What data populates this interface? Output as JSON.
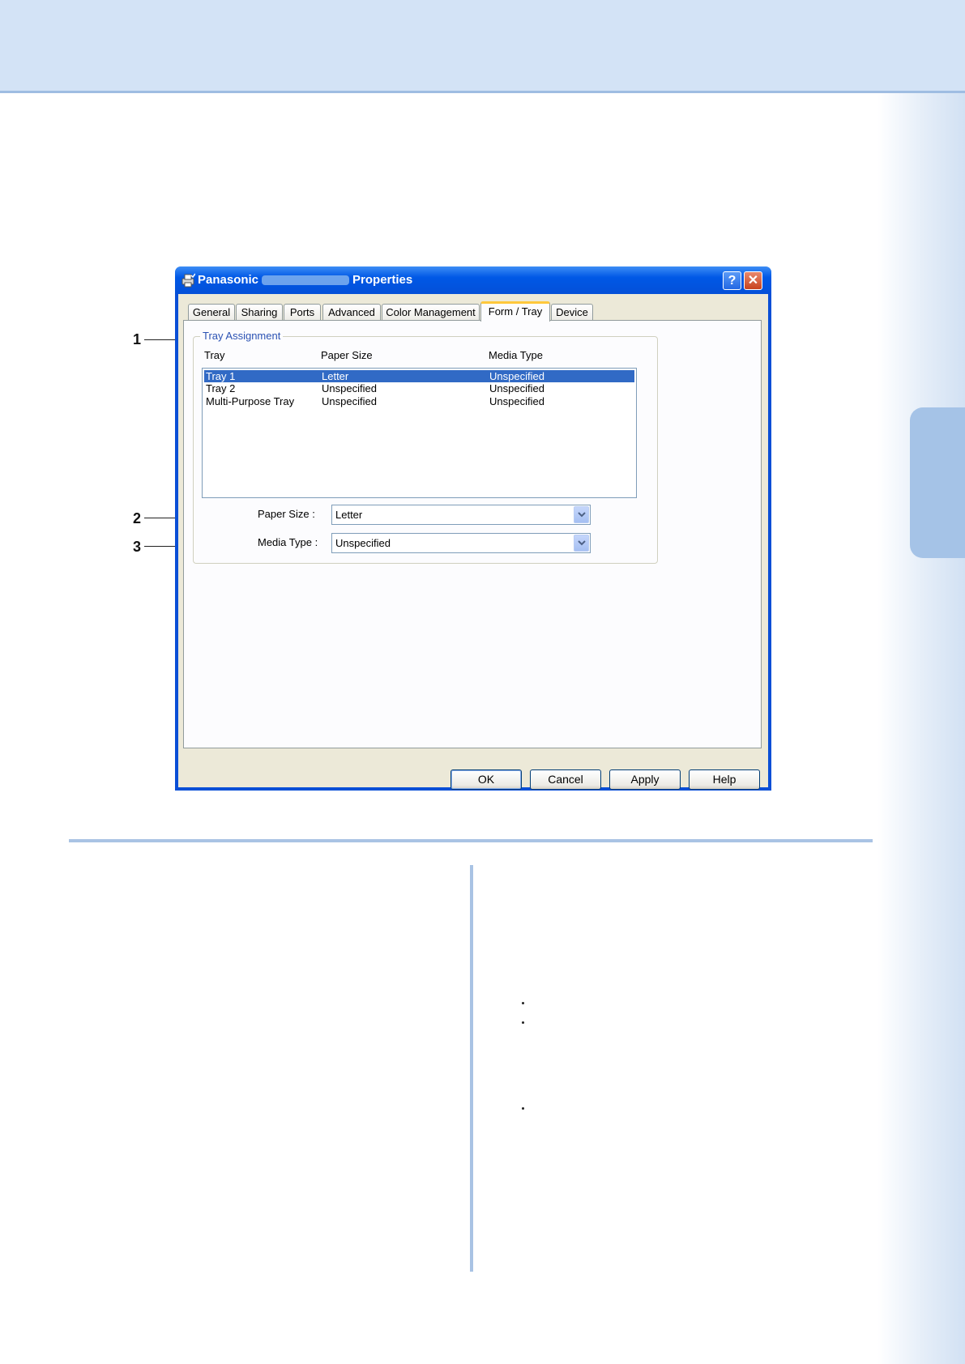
{
  "dialog": {
    "title_prefix": "Panasonic",
    "title_suffix": "Properties",
    "help_glyph": "?",
    "close_glyph": "✕",
    "tabs": [
      {
        "label": "General"
      },
      {
        "label": "Sharing"
      },
      {
        "label": "Ports"
      },
      {
        "label": "Advanced"
      },
      {
        "label": "Color Management"
      },
      {
        "label": "Form / Tray"
      },
      {
        "label": "Device"
      }
    ],
    "active_tab": "Form / Tray",
    "tray_group": {
      "label": "Tray Assignment",
      "columns": [
        "Tray",
        "Paper Size",
        "Media Type"
      ],
      "rows": [
        {
          "tray": "Tray 1",
          "paper": "Letter",
          "media": "Unspecified",
          "selected": true
        },
        {
          "tray": "Tray 2",
          "paper": "Unspecified",
          "media": "Unspecified",
          "selected": false
        },
        {
          "tray": "Multi-Purpose Tray",
          "paper": "Unspecified",
          "media": "Unspecified",
          "selected": false
        }
      ],
      "paper_size_label": "Paper Size :",
      "paper_size_value": "Letter",
      "media_type_label": "Media Type :",
      "media_type_value": "Unspecified"
    },
    "buttons": {
      "ok": "OK",
      "cancel": "Cancel",
      "apply": "Apply",
      "help": "Help"
    }
  },
  "callouts": [
    "1",
    "2",
    "3"
  ],
  "colors": {
    "title_bar": "#0058e6",
    "selection": "#316ac5",
    "accent_band": "#d3e3f6",
    "rule": "#a9c3e4"
  }
}
